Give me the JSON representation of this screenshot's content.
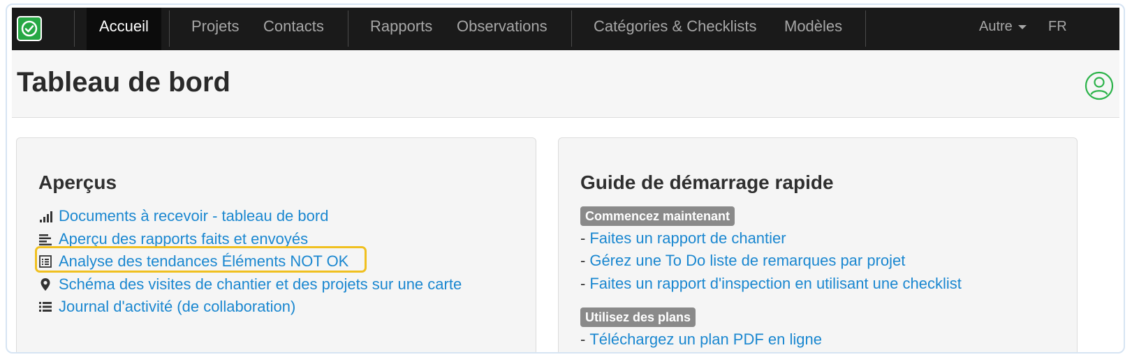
{
  "navbar": {
    "items": [
      {
        "label": "Accueil",
        "active": true
      },
      {
        "label": "Projets"
      },
      {
        "label": "Contacts"
      },
      {
        "label": "Rapports"
      },
      {
        "label": "Observations"
      },
      {
        "label": "Catégories & Checklists"
      },
      {
        "label": "Modèles"
      }
    ],
    "more_label": "Autre",
    "language": "FR"
  },
  "header": {
    "title": "Tableau de bord"
  },
  "overviews": {
    "title": "Aperçus",
    "items": [
      {
        "label": "Documents à recevoir - tableau de bord",
        "icon": "signal-bars-icon"
      },
      {
        "label": "Aperçu des rapports faits et envoyés",
        "icon": "align-left-icon"
      },
      {
        "label": "Analyse des tendances Éléments NOT OK",
        "icon": "list-alt-icon",
        "highlighted": true
      },
      {
        "label": "Schéma des visites de chantier et des projets sur une carte",
        "icon": "map-marker-icon"
      },
      {
        "label": "Journal d'activité (de collaboration)",
        "icon": "list-icon"
      }
    ]
  },
  "guide": {
    "title": "Guide de démarrage rapide",
    "dash": "-",
    "sections": [
      {
        "badge": "Commencez maintenant",
        "links": [
          "Faites un rapport de chantier",
          "Gérez une To Do liste de remarques par projet",
          "Faites un rapport d'inspection en utilisant une checklist"
        ]
      },
      {
        "badge": "Utilisez des plans",
        "links": [
          "Téléchargez un plan PDF en ligne"
        ]
      }
    ]
  },
  "colors": {
    "navbar_bg": "#1a1a1a",
    "link": "#1a87d0",
    "brand_green": "#27a844",
    "highlight": "#f0c020",
    "badge_bg": "#8a8a8a"
  }
}
